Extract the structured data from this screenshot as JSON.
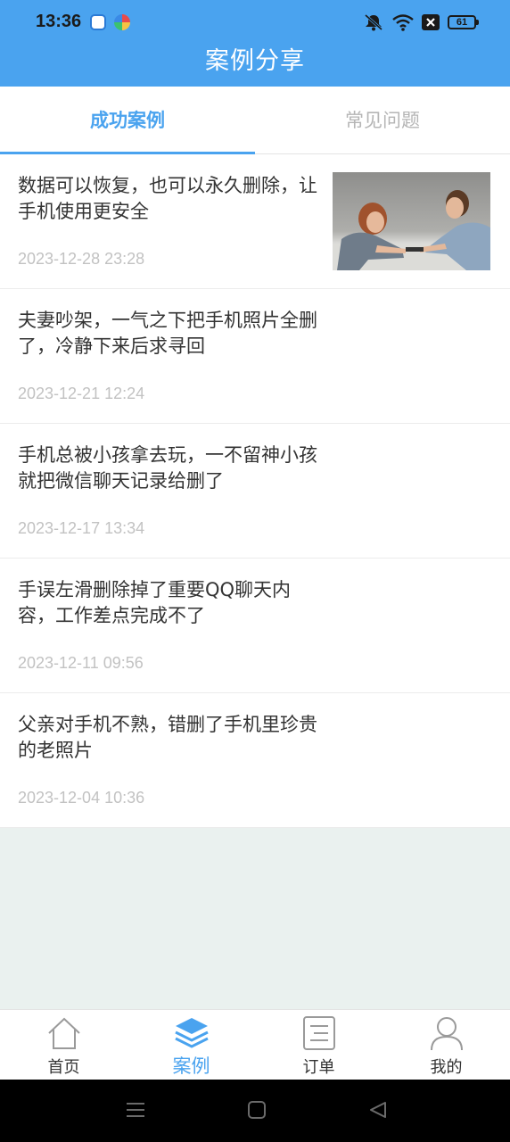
{
  "status_bar": {
    "time": "13:36",
    "battery": "61"
  },
  "header": {
    "title": "案例分享"
  },
  "tabs": [
    {
      "label": "成功案例",
      "active": true
    },
    {
      "label": "常见问题",
      "active": false
    }
  ],
  "cases": [
    {
      "title": "数据可以恢复，也可以永久删除，让手机使用更安全",
      "date": "2023-12-28 23:28",
      "has_image": true
    },
    {
      "title": "夫妻吵架，一气之下把手机照片全删了，冷静下来后求寻回",
      "date": "2023-12-21 12:24",
      "has_image": false
    },
    {
      "title": "手机总被小孩拿去玩，一不留神小孩就把微信聊天记录给删了",
      "date": "2023-12-17 13:34",
      "has_image": false
    },
    {
      "title": "手误左滑删除掉了重要QQ聊天内容，工作差点完成不了",
      "date": "2023-12-11 09:56",
      "has_image": false
    },
    {
      "title": "父亲对手机不熟，错删了手机里珍贵的老照片",
      "date": "2023-12-04 10:36",
      "has_image": false
    }
  ],
  "bottom_nav": [
    {
      "label": "首页",
      "icon": "home-icon",
      "active": false
    },
    {
      "label": "案例",
      "icon": "layers-icon",
      "active": true
    },
    {
      "label": "订单",
      "icon": "order-list-icon",
      "active": false
    },
    {
      "label": "我的",
      "icon": "user-icon",
      "active": false
    }
  ],
  "colors": {
    "primary": "#4aa3ef",
    "background": "#eaf1ef",
    "text": "#333333",
    "muted": "#c2c2c2"
  }
}
